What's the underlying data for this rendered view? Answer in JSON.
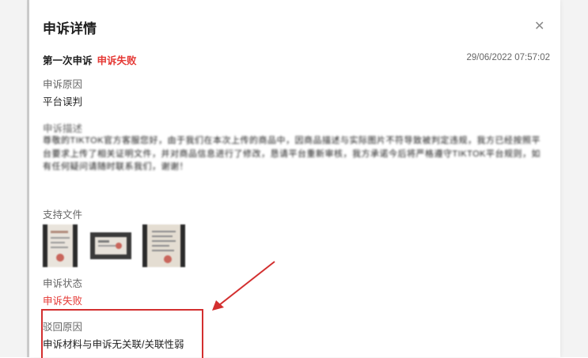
{
  "modal": {
    "title": "申诉详情",
    "close_icon": "close-icon"
  },
  "appeal": {
    "round_label": "第一次申诉",
    "result_tag": "申诉失败",
    "timestamp": "29/06/2022 07:57:02",
    "reason_label": "申诉原因",
    "reason_value": "平台误判",
    "description_label": "申诉描述",
    "description_text": "尊敬的TIKTOK官方客服您好，由于我们在本次上传的商品中，因商品描述与实际图片不符导致被判定违规，我方已经按照平台要求上传了相关证明文件，并对商品信息进行了修改，恳请平台重新审核，我方承诺今后将严格遵守TIKTOK平台规则，如有任何疑问请随时联系我们，谢谢！",
    "files_label": "支持文件",
    "status_label": "申诉状态",
    "status_value": "申诉失败",
    "reject_label": "驳回原因",
    "reject_value": "申诉材料与申诉无关联/关联性弱"
  },
  "colors": {
    "accent_red": "#e53935",
    "annotation_red": "#d32f2f"
  }
}
